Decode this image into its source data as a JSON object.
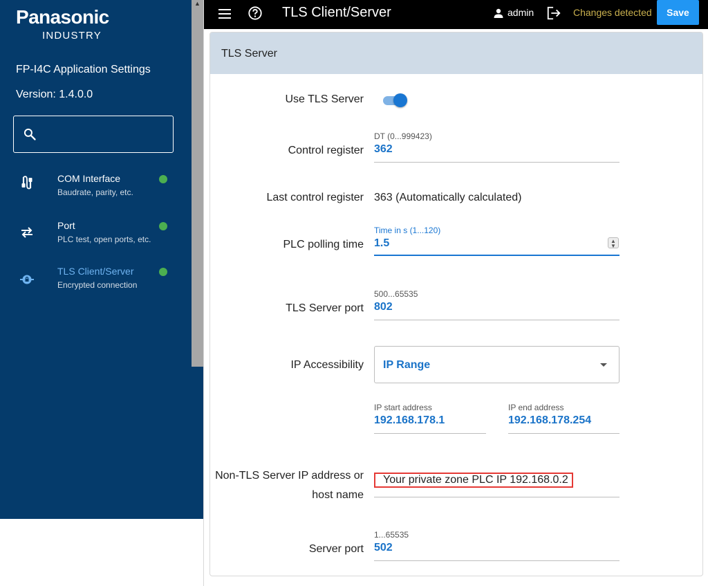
{
  "sidebar": {
    "logo_main": "Panasonic",
    "logo_sub": "INDUSTRY",
    "app_title": "FP-I4C Application Settings",
    "version": "Version: 1.4.0.0",
    "search_placeholder": "",
    "items": [
      {
        "title": "COM Interface",
        "subtitle": "Baudrate, parity, etc.",
        "icon": "cable-icon",
        "status_color": "#4caf50"
      },
      {
        "title": "Port",
        "subtitle": "PLC test, open ports, etc.",
        "icon": "swap-arrows-icon",
        "status_color": "#4caf50"
      },
      {
        "title": "TLS Client/Server",
        "subtitle": "Encrypted connection",
        "icon": "lock-network-icon",
        "status_color": "#4caf50",
        "active": true
      }
    ]
  },
  "topbar": {
    "title": "TLS Client/Server",
    "user": "admin",
    "changes": "Changes detected",
    "save_label": "Save"
  },
  "card": {
    "title": "TLS Server",
    "use_tls_label": "Use TLS Server",
    "use_tls_enabled": true,
    "control_register": {
      "label": "Control register",
      "hint": "DT (0...999423)",
      "value": "362"
    },
    "last_control_register": {
      "label": "Last control register",
      "value": "363 (Automatically calculated)"
    },
    "plc_polling": {
      "label": "PLC polling time",
      "hint": "Time in s (1...120)",
      "value": "1.5"
    },
    "tls_port": {
      "label": "TLS Server port",
      "hint": "500...65535",
      "value": "802"
    },
    "ip_accessibility": {
      "label": "IP Accessibility",
      "value": "IP Range"
    },
    "ip_start": {
      "hint": "IP start address",
      "value": "192.168.178.1"
    },
    "ip_end": {
      "hint": "IP end address",
      "value": "192.168.178.254"
    },
    "non_tls": {
      "label_line1": "Non-TLS Server IP address or",
      "label_line2": "host name",
      "value": "Your private zone PLC IP 192.168.0.2"
    },
    "server_port": {
      "label": "Server port",
      "hint": "1...65535",
      "value": "502"
    }
  },
  "colors": {
    "sidebar_bg": "#053b6b",
    "accent": "#1a73c8",
    "save_button": "#2196f3",
    "changes_text": "#c9b04e",
    "highlight_border": "#e53935"
  }
}
